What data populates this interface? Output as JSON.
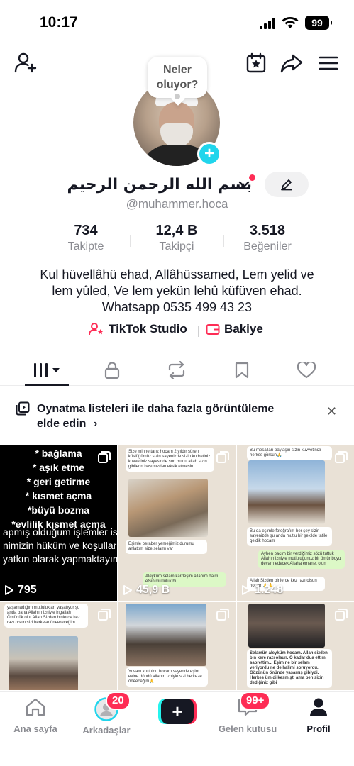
{
  "status_bar": {
    "time": "10:17",
    "battery": "99"
  },
  "header": {
    "add_friend_icon": "person-plus-icon",
    "calendar_icon": "calendar-star-icon",
    "share_icon": "share-arrow-icon",
    "menu_icon": "hamburger-menu-icon"
  },
  "profile": {
    "bubble_text": "Neler oluyor?",
    "display_name": "بسم الله الرحمن الرحيم",
    "handle": "@muhammer.hoca",
    "stats": [
      {
        "value": "734",
        "label": "Takipte"
      },
      {
        "value": "12,4 B",
        "label": "Takipçi"
      },
      {
        "value": "3.518",
        "label": "Beğeniler"
      }
    ],
    "bio_line1": "Kul hüvellâhü ehad, Allâhüssamed, Lem yelid ve",
    "bio_line2": "lem yûled, Ve lem yekün lehû küfüven ehad.",
    "bio_line3": "Whatsapp 0535 499 43 23",
    "tiktok_studio": "TikTok Studio",
    "bakiye": "Bakiye"
  },
  "banner": {
    "text": "Oynatma listeleri ile daha fazla görüntüleme elde edin",
    "chevron": "›",
    "close": "✕"
  },
  "grid": {
    "video1": {
      "lines": [
        "* bağlama",
        "* aşık etme",
        "* geri getirme",
        "* kısmet açma",
        "*büyü bozma",
        "*evlilik kısmet açma"
      ],
      "lines2": [
        "apmış olduğum işlemler isla",
        "nimizin hüküm ve koşulları",
        "yatkın olarak yapmaktayım"
      ],
      "views": "795"
    },
    "video2": {
      "msg1": "Size minnettarız hocam 2 yıldır süren küslüğümüz sizin sayenizde sizin kudretiniz kuvvetiniz sayesinde son buldu allah sizin gibilerin başımızdan eksik etmesin",
      "msg2": "Eşimle beraber yemeğimiz durumu anlattım size selamı var",
      "msg3": "Aleyküm selam kardeşim allahım daim etsin mutluluk bu",
      "views": "45,9 B"
    },
    "video3": {
      "msg1": "Bu mesajları paylaşın sizin kuvvetinizi herkes görsün🙏",
      "msg2": "Bu da eşimle fotoğrafım her şey sizin sayenizde şu anda mutlu bir şekilde tatile geldik hocam",
      "msg3": "Ayhen bacım bir verdiğimiz sözü tuttuk Allahın izniyle mutluluğunuz bir ömür boyu devam edecek Allaha emanet olun",
      "msg4": "Allah Sizden binlerce kez razı olsun hocam🙏🙏",
      "views": "1.248"
    },
    "video4": {
      "msg1": "yaşamadığım mutlulukları yaşatıyor şu anda bana Allah'ın izniyle ingallah Ömürlük olur Allah Sizden binlerce kez razı olsun sizi herkese öneereceğim"
    },
    "video5": {
      "msg1": "Yuvam kurtuldu hocam sayende eşim evine döndü allahın izniyle sizi herkeze öneeceğim🙏"
    },
    "video6": {
      "msg1": "Selamün aleyküm hocam. Allah sizden bin kere razı olsun. O kadar dua ettim, sabrettim... Eşim ne bir selam veriyordu ne de halimi soruyordu. Gözünün önünde yaşamış gibiydi. Herkes ümidi kesmişti ama ben sizin dediğiniz gibi"
    }
  },
  "bottom_nav": {
    "home": "Ana sayfa",
    "friends": "Arkadaşlar",
    "friends_badge": "20",
    "inbox": "Gelen kutusu",
    "inbox_badge": "99+",
    "profile": "Profil"
  },
  "colors": {
    "accent": "#fe2c55",
    "cyan": "#20d5ec",
    "text": "#161823",
    "muted": "#8a8b91"
  }
}
